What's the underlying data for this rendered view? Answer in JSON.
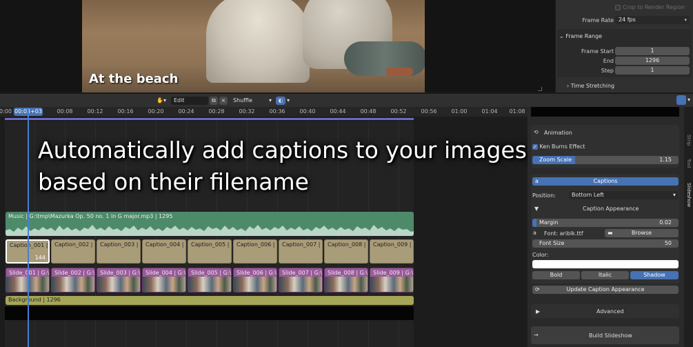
{
  "preview": {
    "caption_text": "At the beach"
  },
  "output_props": {
    "crop_label": "Crop to Render Region",
    "frame_rate_label": "Frame Rate",
    "frame_rate_value": "24 fps",
    "frame_range_title": "Frame Range",
    "frame_start_label": "Frame Start",
    "frame_start_value": "1",
    "end_label": "End",
    "end_value": "1296",
    "step_label": "Step",
    "step_value": "1",
    "time_stretching_label": "Time Stretching"
  },
  "toolbar": {
    "mode_value": "Edit",
    "shuffle_label": "Shuffle"
  },
  "ruler": {
    "ticks": [
      "0:00",
      "00:08",
      "00:12",
      "00:16",
      "00:20",
      "00:24",
      "00:28",
      "00:32",
      "00:36",
      "00:40",
      "00:44",
      "00:48",
      "00:52",
      "00:56",
      "01:00",
      "01:04",
      "01:08"
    ],
    "playhead": "00:03+03"
  },
  "overlay": {
    "line1": "Automatically add captions to your images,",
    "line2": "based on their filename"
  },
  "strips": {
    "music_label": "Music | G:\\tmp\\Mazurka Op. 50 no. 1 in G major.mp3 | 1295",
    "captions": [
      "Caption_001 |",
      "Caption_002 |",
      "Caption_003 |",
      "Caption_004 |",
      "Caption_005 |",
      "Caption_006 |",
      "Caption_007 | L",
      "Caption_008 |",
      "Caption_009 |"
    ],
    "caption_first_count": "144",
    "slides": [
      "Slide_001 | G:\\",
      "Slide_002 | G:\\",
      "Slide_003 | G:\\",
      "Slide_004 | G:\\",
      "Slide_005 | G:\\",
      "Slide_006 | G:\\",
      "Slide_007 | G:\\",
      "Slide_008 | G:\\",
      "Slide_009 | G:\\"
    ],
    "background_label": "Background | 1296"
  },
  "panel": {
    "animation_label": "Animation",
    "ken_burns_label": "Ken Burns Effect",
    "zoom_scale_label": "Zoom Scale",
    "zoom_scale_value": "1.15",
    "captions_label": "Captions",
    "position_label": "Position:",
    "position_value": "Bottom Left",
    "caption_appearance_label": "Caption Appearance",
    "margin_label": "Margin",
    "margin_value": "0.02",
    "font_label": "Font: ariblk.ttf",
    "browse_label": "Browse",
    "font_size_label": "Font Size",
    "font_size_value": "50",
    "color_label": "Color:",
    "bold_label": "Bold",
    "italic_label": "Italic",
    "shadow_label": "Shadow",
    "update_label": "Update Caption Appearance",
    "advanced_label": "Advanced",
    "build_label": "Build Slideshow"
  },
  "side_tabs": [
    "Strip",
    "Tool",
    "Slideshow"
  ],
  "colors": {
    "accent_blue": "#4772b3",
    "music_strip": "#4d8a6a",
    "caption_strip": "#a99c79",
    "slide_strip": "#9a5a9a",
    "background_strip": "#a6a658"
  }
}
